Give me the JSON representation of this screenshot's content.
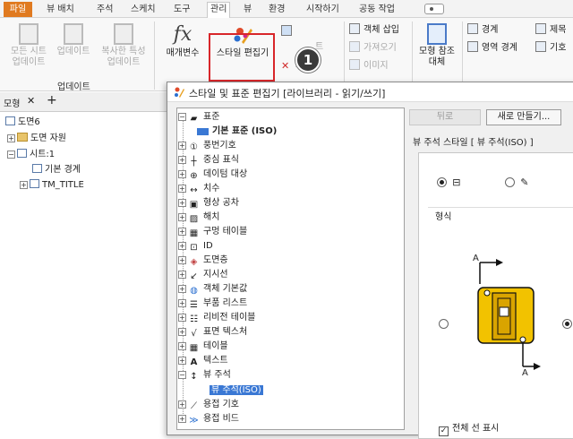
{
  "ribbon_tabs": [
    "파일",
    "뷰 배치",
    "주석",
    "스케치",
    "도구",
    "관리",
    "뷰",
    "환경",
    "시작하기",
    "공동 작업"
  ],
  "active_tab": "관리",
  "ribbon": {
    "update_all_sheets": "모든 시트\n업데이트",
    "update": "업데이트",
    "update_copy_props": "복사한 특성\n업데이트",
    "parameters": "매개변수",
    "style_editor": "스타일 편집기",
    "style_small_1": "트",
    "purge": "소거",
    "insert_object": "객체 삽입",
    "import": "가져오기",
    "image": "이미지",
    "replace_model_ref": "모형 참조\n대체",
    "boundary": "경계",
    "region_boundary": "영역 경계",
    "remove": "제목",
    "base": "기호",
    "group_update": "업데이트",
    "callout_number": "1"
  },
  "browser": {
    "tab_label": "모형",
    "nodes": [
      "도면6",
      "도면 자원",
      "시트:1",
      "기본 경계",
      "TM_TITLE"
    ]
  },
  "dialog": {
    "title": "스타일 및 표준 편집기 [라이브러리 - 읽기/쓰기]",
    "buttons": {
      "back": "뒤로",
      "new": "새로 만들기..."
    },
    "subtitle": "뷰 주석 스타일 [ 뷰 주석(ISO) ]",
    "section_label": "형식",
    "show_all_lines": "전체 선 표시",
    "arrow_label_a": "A",
    "tree": [
      {
        "label": "표준",
        "level": 0,
        "expanded": true
      },
      {
        "label": "기본 표준 (ISO)",
        "level": 1,
        "bold": true
      },
      {
        "label": "풍번기호",
        "level": 0
      },
      {
        "label": "중심 표식",
        "level": 0
      },
      {
        "label": "데이텀 대상",
        "level": 0
      },
      {
        "label": "치수",
        "level": 0
      },
      {
        "label": "형상 공차",
        "level": 0
      },
      {
        "label": "해치",
        "level": 0
      },
      {
        "label": "구멍 테이블",
        "level": 0
      },
      {
        "label": "ID",
        "level": 0
      },
      {
        "label": "도면층",
        "level": 0
      },
      {
        "label": "지시선",
        "level": 0
      },
      {
        "label": "객체 기본값",
        "level": 0
      },
      {
        "label": "부품 리스트",
        "level": 0
      },
      {
        "label": "리비전 테이블",
        "level": 0
      },
      {
        "label": "표면 텍스처",
        "level": 0
      },
      {
        "label": "테이블",
        "level": 0
      },
      {
        "label": "텍스트",
        "level": 0
      },
      {
        "label": "뷰 주석",
        "level": 0,
        "expanded": true
      },
      {
        "label": "뷰 주석(ISO)",
        "level": 1,
        "selected": true
      },
      {
        "label": "용접 기호",
        "level": 0
      },
      {
        "label": "용접 비드",
        "level": 0
      }
    ]
  },
  "colors": {
    "file_tab": "#e07a20",
    "highlight_box": "#d8262a",
    "selection": "#3a78d4",
    "preview_yellow": "#f2c200"
  }
}
